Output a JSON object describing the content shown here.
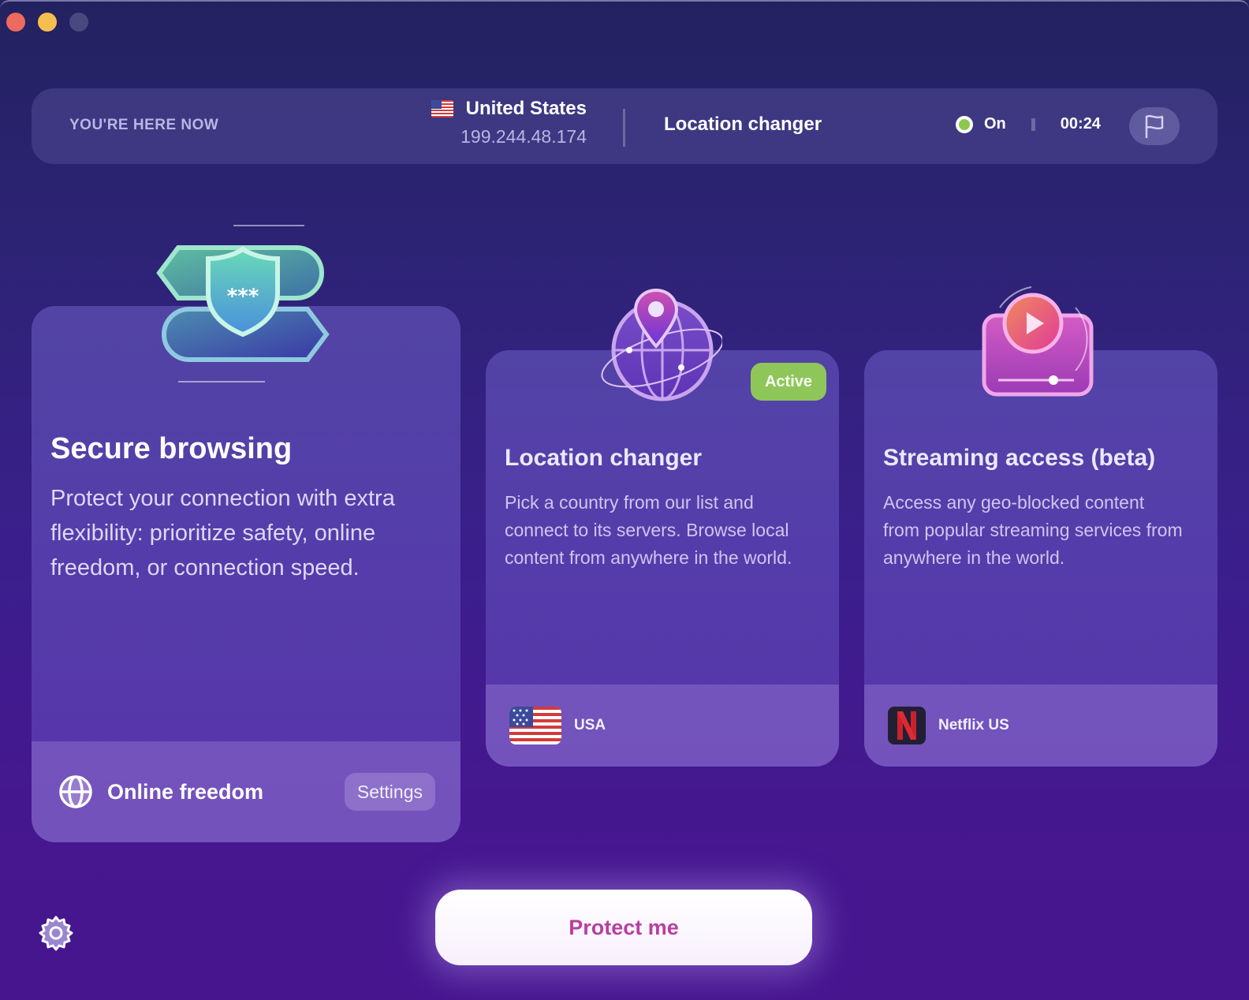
{
  "window": {
    "controls": [
      "close",
      "minimize",
      "zoom"
    ]
  },
  "topbar": {
    "here_label": "YOU'RE HERE NOW",
    "country": "United States",
    "ip": "199.244.48.174",
    "active_feature": "Location changer",
    "status": "On",
    "timer": "00:24",
    "status_color": "#8cc84b",
    "flag_button_icon": "flag-icon"
  },
  "cards": [
    {
      "title": "Secure browsing",
      "description": "Protect your connection with extra flexibility: prioritize safety, online freedom, or connection speed.",
      "footer_label": "Online freedom",
      "footer_icon": "globe-icon",
      "settings_label": "Settings"
    },
    {
      "title": "Location changer",
      "description": "Pick a country from our list and connect to its servers. Browse local content from anywhere in the world.",
      "badge": "Active",
      "badge_color": "#8fc65a",
      "footer_label": "USA",
      "footer_icon": "us-flag-icon"
    },
    {
      "title": "Streaming access (beta)",
      "description": "Access any geo-blocked content from popular streaming services from anywhere in the world.",
      "footer_label": "Netflix US",
      "footer_icon": "netflix-icon"
    }
  ],
  "actions": {
    "protect_label": "Protect me",
    "protect_color": "#b83fa0",
    "settings_icon": "gear-icon"
  }
}
